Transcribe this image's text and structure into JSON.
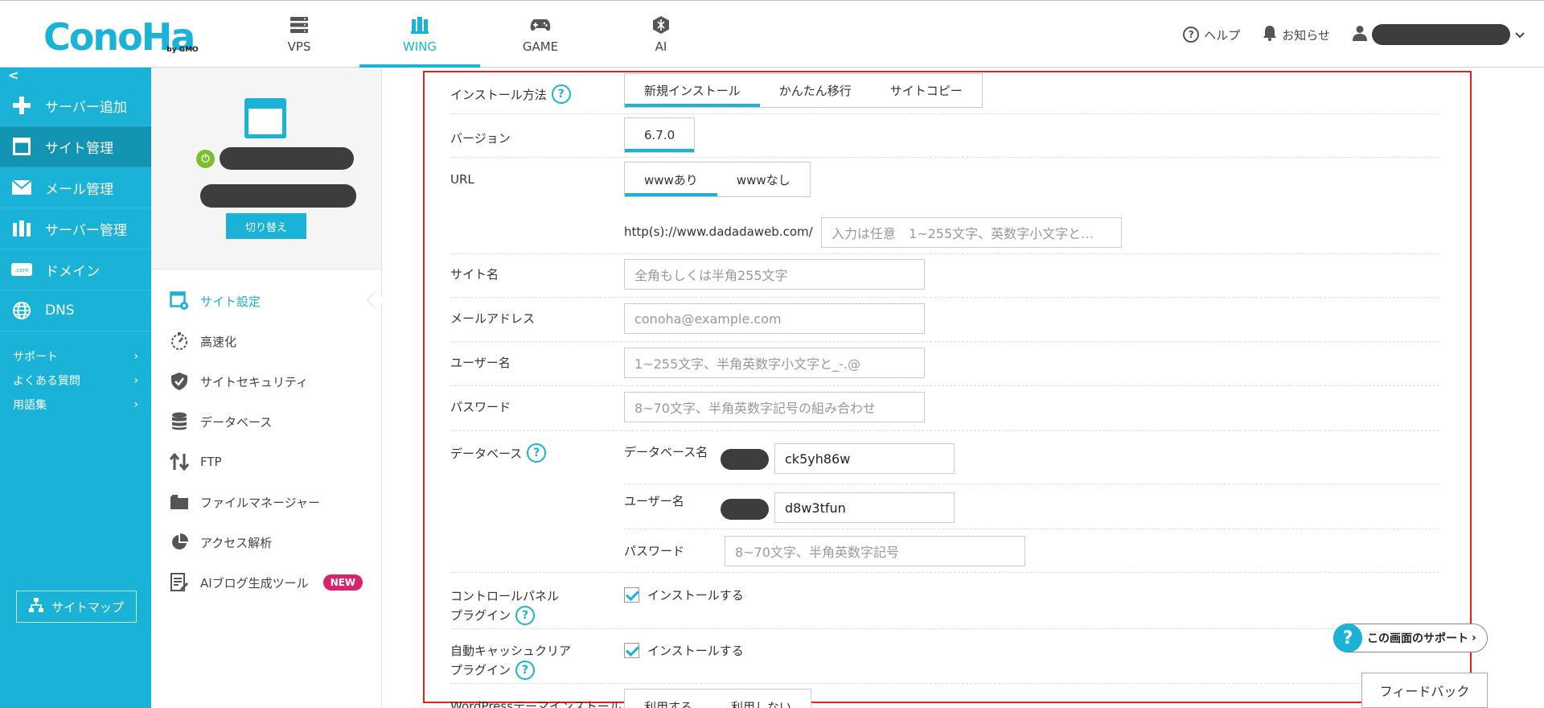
{
  "header": {
    "logo": "ConoHa",
    "logo_sub": "by GMO",
    "nav": [
      {
        "label": "VPS",
        "icon": "server-icon"
      },
      {
        "label": "WING",
        "icon": "wing-icon",
        "active": true
      },
      {
        "label": "GAME",
        "icon": "gamepad-icon"
      },
      {
        "label": "AI",
        "icon": "ai-icon"
      }
    ],
    "help": "ヘルプ",
    "notice": "お知らせ"
  },
  "sidebar": {
    "collapse": "<",
    "items": [
      {
        "label": "サーバー追加",
        "icon": "plus-icon"
      },
      {
        "label": "サイト管理",
        "icon": "window-icon",
        "active": true
      },
      {
        "label": "メール管理",
        "icon": "mail-icon"
      },
      {
        "label": "サーバー管理",
        "icon": "server-manage-icon"
      },
      {
        "label": "ドメイン",
        "icon": "domain-icon"
      },
      {
        "label": "DNS",
        "icon": "globe-icon"
      }
    ],
    "sub": [
      {
        "label": "サポート"
      },
      {
        "label": "よくある質問"
      },
      {
        "label": "用語集"
      }
    ],
    "sitemap": "サイトマップ"
  },
  "panel2": {
    "switch": "切り替え",
    "items": [
      {
        "label": "サイト設定",
        "icon": "site-settings-icon",
        "active": true
      },
      {
        "label": "高速化",
        "icon": "speed-icon"
      },
      {
        "label": "サイトセキュリティ",
        "icon": "shield-icon"
      },
      {
        "label": "データベース",
        "icon": "database-icon"
      },
      {
        "label": "FTP",
        "icon": "transfer-icon"
      },
      {
        "label": "ファイルマネージャー",
        "icon": "folder-icon"
      },
      {
        "label": "アクセス解析",
        "icon": "pie-icon"
      },
      {
        "label": "AIブログ生成ツール",
        "icon": "ai-blog-icon",
        "badge": "NEW"
      }
    ]
  },
  "form": {
    "install_method": {
      "label": "インストール方法",
      "options": [
        "新規インストール",
        "かんたん移行",
        "サイトコピー"
      ]
    },
    "version": {
      "label": "バージョン",
      "value": "6.7.0"
    },
    "url": {
      "label": "URL",
      "options": [
        "wwwあり",
        "wwwなし"
      ],
      "prefix": "http(s)://www.dadadaweb.com/",
      "path_placeholder": "入力は任意　1~255文字、英数字小文字と…"
    },
    "site_name": {
      "label": "サイト名",
      "placeholder": "全角もしくは半角255文字"
    },
    "email": {
      "label": "メールアドレス",
      "placeholder": "conoha@example.com"
    },
    "username": {
      "label": "ユーザー名",
      "placeholder": "1~255文字、半角英数字小文字と_-.@"
    },
    "password": {
      "label": "パスワード",
      "placeholder": "8~70文字、半角英数字記号の組み合わせ"
    },
    "database": {
      "label": "データベース",
      "db_name_label": "データベース名",
      "db_name_value": "ck5yh86w",
      "db_user_label": "ユーザー名",
      "db_user_value": "d8w3tfun",
      "db_pass_label": "パスワード",
      "db_pass_placeholder": "8~70文字、半角英数字記号"
    },
    "cp_plugin": {
      "label1": "コントロールパネル",
      "label2": "プラグイン",
      "check": "インストールする"
    },
    "cache_plugin": {
      "label1": "自動キャッシュクリア",
      "label2": "プラグイン",
      "check": "インストールする"
    },
    "theme": {
      "label": "WordPressテーマインストール",
      "options": [
        "利用する",
        "利用しない"
      ]
    }
  },
  "support_btn": "この画面のサポート",
  "feedback_btn": "フィードバック"
}
